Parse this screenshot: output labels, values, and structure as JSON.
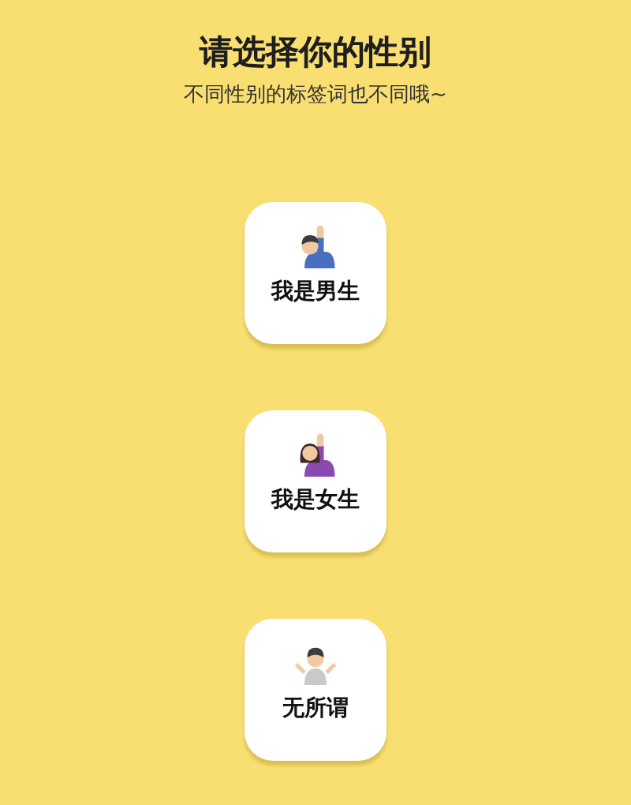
{
  "title": "请选择你的性别",
  "subtitle": "不同性别的标签词也不同哦~",
  "options": [
    {
      "label": "我是男生",
      "kind": "man"
    },
    {
      "label": "我是女生",
      "kind": "woman"
    },
    {
      "label": "无所谓",
      "kind": "shrug"
    }
  ]
}
